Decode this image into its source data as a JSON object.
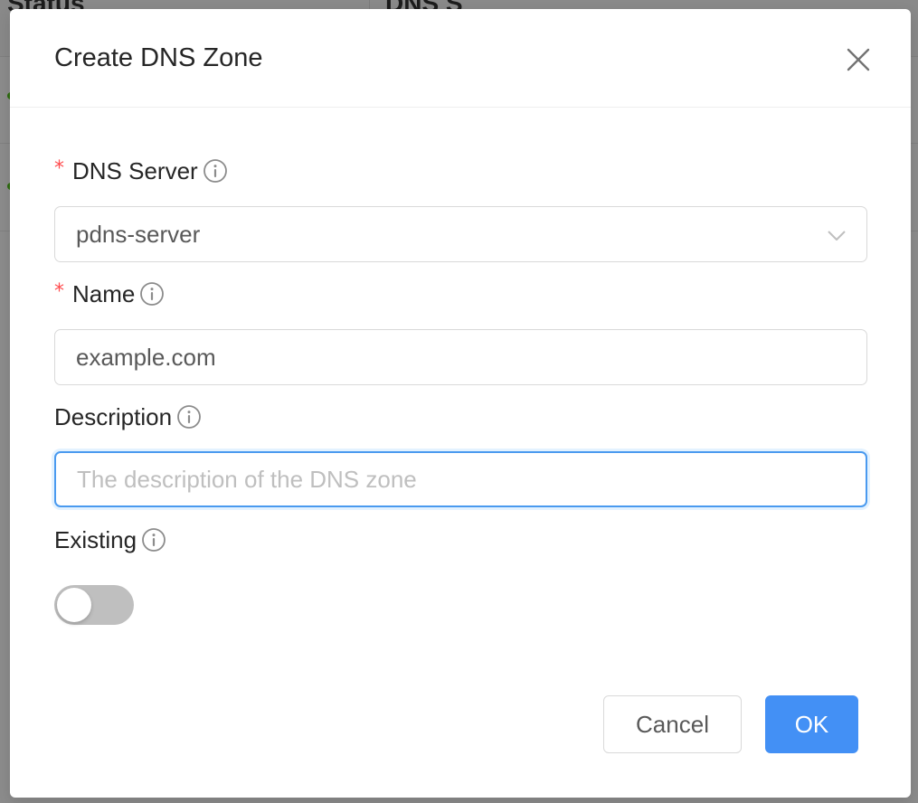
{
  "background": {
    "col1_header": "Status",
    "col2_header": "DNS S"
  },
  "dialog": {
    "title": "Create DNS Zone",
    "fields": {
      "dns_server": {
        "label": "DNS Server",
        "required": true,
        "value": "pdns-server"
      },
      "name": {
        "label": "Name",
        "required": true,
        "value": "example.com"
      },
      "description": {
        "label": "Description",
        "required": false,
        "value": "",
        "placeholder": "The description of the DNS zone"
      },
      "existing": {
        "label": "Existing",
        "required": false,
        "checked": false
      }
    },
    "buttons": {
      "cancel": "Cancel",
      "ok": "OK"
    },
    "required_marker": "*",
    "colors": {
      "primary": "#4390f5",
      "required": "#ff4d4f",
      "focus_border": "#4a9aef",
      "switch_off": "#bfbfbf"
    },
    "icons": {
      "close": "close-icon",
      "info": "info-circle-icon",
      "select_arrow": "chevron-down-icon"
    }
  }
}
